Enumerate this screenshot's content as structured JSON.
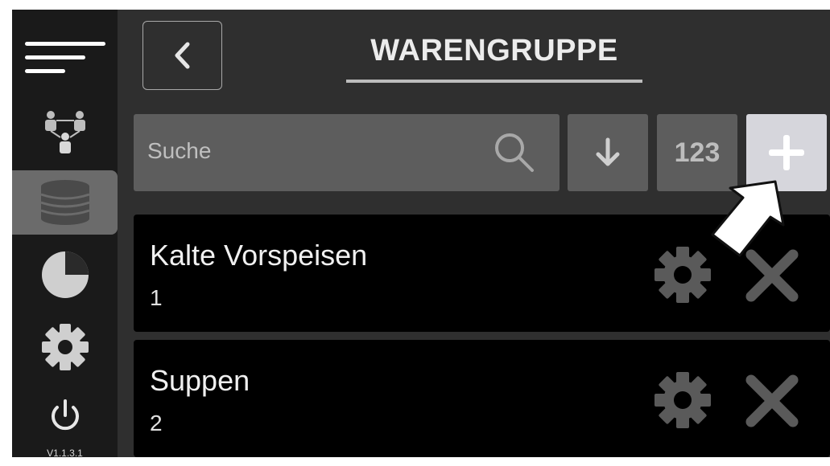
{
  "header": {
    "title": "WARENGRUPPE",
    "back_icon": "chevron-left-icon"
  },
  "sidebar": {
    "items": [
      {
        "name": "menu",
        "icon": "hamburger-menu-icon",
        "active": false
      },
      {
        "name": "users",
        "icon": "users-hierarchy-icon",
        "active": false
      },
      {
        "name": "database",
        "icon": "database-icon",
        "active": true
      },
      {
        "name": "statistics",
        "icon": "pie-chart-icon",
        "active": false
      },
      {
        "name": "settings",
        "icon": "gear-icon",
        "active": false
      },
      {
        "name": "power",
        "icon": "power-icon",
        "active": false
      }
    ],
    "version": "V1.1.3.1"
  },
  "toolbar": {
    "search_placeholder": "Suche",
    "sort_icon": "arrow-down-icon",
    "numeric_label": "123",
    "add_icon": "plus-icon"
  },
  "groups": [
    {
      "name": "Kalte Vorspeisen",
      "number": "1"
    },
    {
      "name": "Suppen",
      "number": "2"
    }
  ],
  "colors": {
    "background": "#2f2f2f",
    "sidebar": "#1a1a1a",
    "active_item": "#6b6b6b",
    "button": "#5d5d5d",
    "add_button": "#d6d6dc",
    "row": "#000000"
  }
}
